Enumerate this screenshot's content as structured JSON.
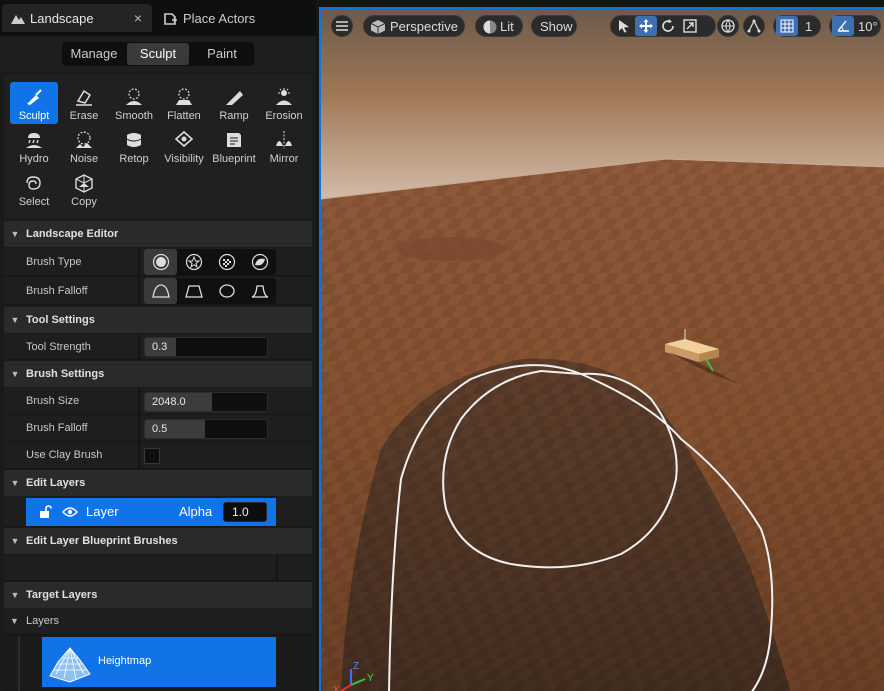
{
  "tabs": [
    {
      "label": "Landscape"
    },
    {
      "label": "Place Actors"
    }
  ],
  "tab_close": "×",
  "modes": [
    "Manage",
    "Sculpt",
    "Paint"
  ],
  "active_mode": "Sculpt",
  "tools": [
    {
      "label": "Sculpt",
      "icon": "sculpt-icon"
    },
    {
      "label": "Erase",
      "icon": "erase-icon"
    },
    {
      "label": "Smooth",
      "icon": "smooth-icon"
    },
    {
      "label": "Flatten",
      "icon": "flatten-icon"
    },
    {
      "label": "Ramp",
      "icon": "ramp-icon"
    },
    {
      "label": "Erosion",
      "icon": "erosion-icon"
    },
    {
      "label": "Hydro",
      "icon": "hydro-icon"
    },
    {
      "label": "Noise",
      "icon": "noise-icon"
    },
    {
      "label": "Retop",
      "icon": "retop-icon"
    },
    {
      "label": "Visibility",
      "icon": "visibility-icon"
    },
    {
      "label": "Blueprint",
      "icon": "blueprint-icon"
    },
    {
      "label": "Mirror",
      "icon": "mirror-icon"
    },
    {
      "label": "Select",
      "icon": "select-icon"
    },
    {
      "label": "Copy",
      "icon": "copy-icon"
    }
  ],
  "active_tool": "Sculpt",
  "sections": {
    "landscape_editor": "Landscape Editor",
    "tool_settings": "Tool Settings",
    "brush_settings": "Brush Settings",
    "edit_layers": "Edit Layers",
    "edit_layer_bp_brushes": "Edit Layer Blueprint Brushes",
    "target_layers": "Target Layers",
    "layers": "Layers"
  },
  "properties": {
    "brush_type": {
      "label": "Brush Type"
    },
    "brush_falloff_type": {
      "label": "Brush Falloff"
    },
    "tool_strength": {
      "label": "Tool Strength",
      "value": "0.3",
      "fraction": 0.25
    },
    "brush_size": {
      "label": "Brush Size",
      "value": "2048.0",
      "fraction": 0.55
    },
    "brush_falloff": {
      "label": "Brush Falloff",
      "value": "0.5",
      "fraction": 0.49
    },
    "use_clay_brush": {
      "label": "Use Clay Brush",
      "checked": false
    }
  },
  "edit_layer": {
    "name": "Layer",
    "alpha_label": "Alpha",
    "alpha_value": "1.0"
  },
  "target_layer": {
    "name": "Heightmap"
  },
  "viewport": {
    "perspective": "Perspective",
    "lit": "Lit",
    "show": "Show",
    "grid_size": "1",
    "angle_snap": "10°",
    "axis_x": "X",
    "axis_y": "Y",
    "axis_z": "Z"
  },
  "colors": {
    "accent": "#1173e8",
    "panel": "#1e1e1e",
    "ground": "#8a5333"
  }
}
